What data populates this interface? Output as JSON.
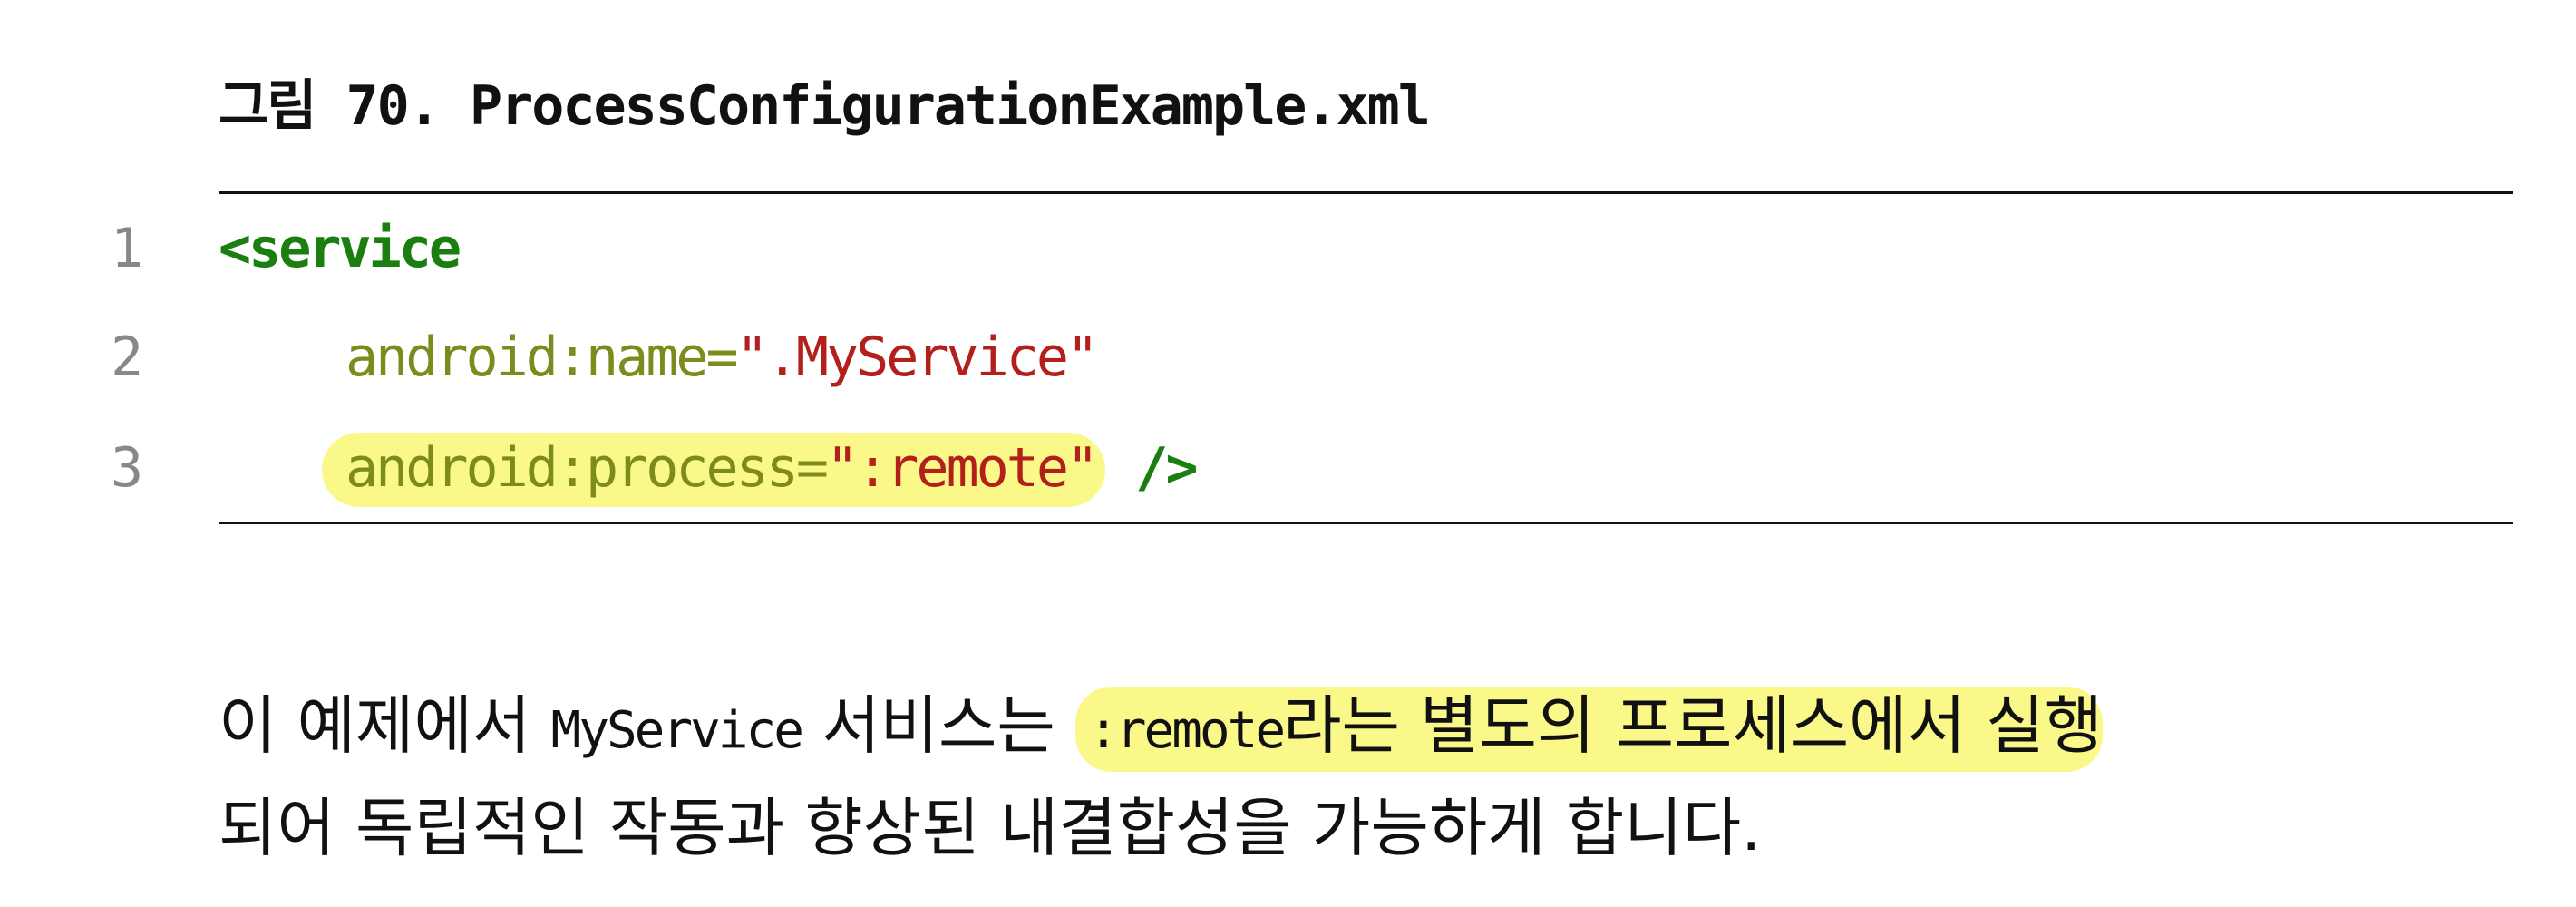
{
  "figure": {
    "caption": "그림 70. ProcessConfigurationExample.xml"
  },
  "code": {
    "lines": [
      {
        "number": "1",
        "tag_open": "<service",
        "attr_name": "",
        "attr_eq": "",
        "attr_value": "",
        "tag_close": ""
      },
      {
        "number": "2",
        "tag_open": "",
        "attr_name": "android:name=",
        "attr_eq": "",
        "attr_value": "\".MyService\"",
        "tag_close": ""
      },
      {
        "number": "3",
        "tag_open": "",
        "attr_name": "android:process=",
        "attr_eq": "",
        "attr_value": "\":remote\"",
        "tag_close": "/>"
      }
    ],
    "colors": {
      "tag": "#1a7f10",
      "attribute": "#7d8a1c",
      "string": "#b3201c",
      "highlight": "#fbf88a",
      "line_number": "#888888"
    }
  },
  "paragraph": {
    "p1_prefix": "이 예제에서 ",
    "p1_code": "MyService",
    "p1_mid": " 서비스는 ",
    "p1_hl_code": ":remote",
    "p1_hl_text": "라는 별도의 프로세스에서 실행",
    "p2": "되어 독립적인 작동과 향상된 내결합성을 가능하게 합니다."
  }
}
